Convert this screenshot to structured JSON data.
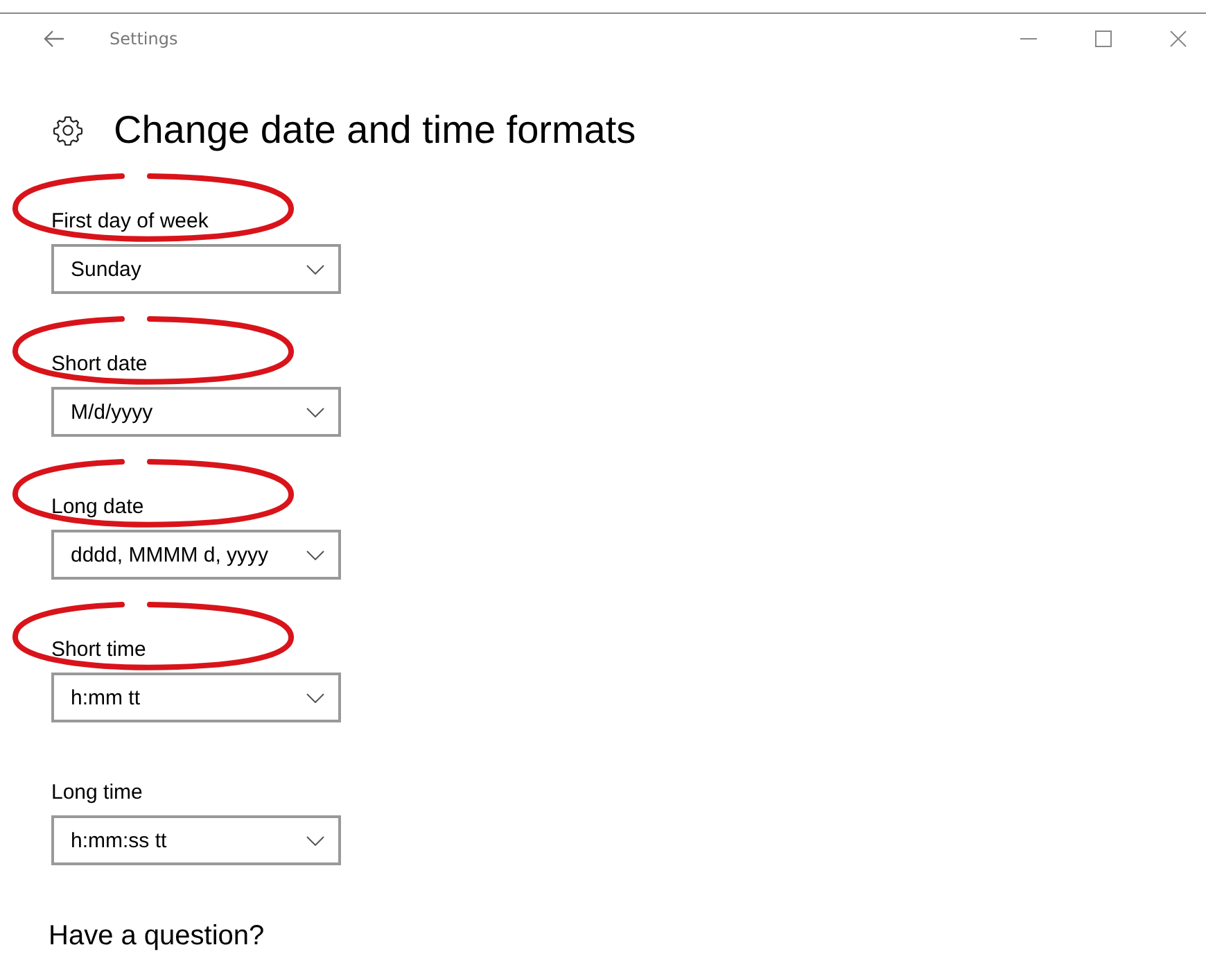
{
  "window": {
    "title": "Settings"
  },
  "page": {
    "title": "Change date and time formats"
  },
  "fields": [
    {
      "label": "First day of week",
      "value": "Sunday",
      "highlighted": true
    },
    {
      "label": "Short date",
      "value": "M/d/yyyy",
      "highlighted": true
    },
    {
      "label": "Long date",
      "value": "dddd, MMMM d, yyyy",
      "highlighted": true
    },
    {
      "label": "Short time",
      "value": "h:mm tt",
      "highlighted": true
    },
    {
      "label": "Long time",
      "value": "h:mm:ss tt",
      "highlighted": false
    }
  ],
  "help": {
    "title": "Have a question?"
  }
}
